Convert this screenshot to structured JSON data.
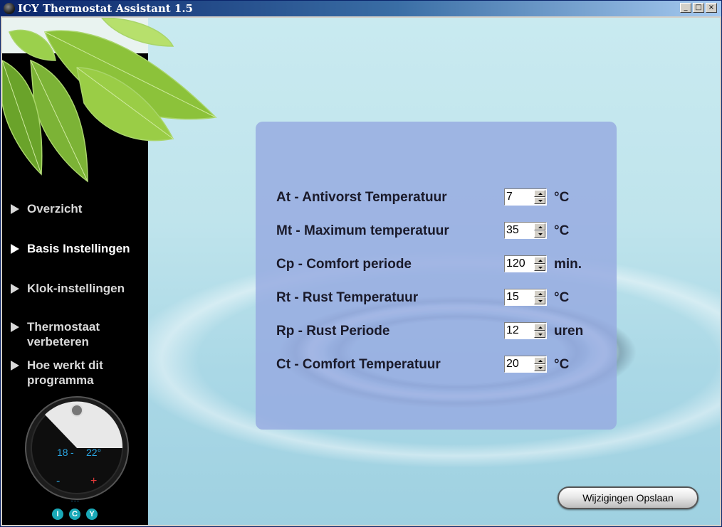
{
  "window": {
    "title": "ICY Thermostat Assistant 1.5"
  },
  "titlebar_buttons": {
    "minimize": "_",
    "maximize": "□",
    "close": "×"
  },
  "sidebar": {
    "items": [
      {
        "label": "Overzicht",
        "active": false
      },
      {
        "label": "Basis Instellingen",
        "active": true
      },
      {
        "label": "Klok-instellingen",
        "active": false
      },
      {
        "label": "Thermostaat verbeteren",
        "active": false
      },
      {
        "label": "Hoe werkt dit programma",
        "active": false
      }
    ]
  },
  "dial": {
    "low": "18",
    "high": "22°",
    "minus": "-",
    "plus": "+",
    "dots": "•••"
  },
  "logo": [
    "I",
    "C",
    "Y"
  ],
  "settings": [
    {
      "label": "At - Antivorst Temperatuur",
      "value": "7",
      "unit": "°C"
    },
    {
      "label": "Mt - Maximum temperatuur",
      "value": "35",
      "unit": "°C"
    },
    {
      "label": "Cp - Comfort periode",
      "value": "120",
      "unit": "min."
    },
    {
      "label": "Rt - Rust Temperatuur",
      "value": "15",
      "unit": "°C"
    },
    {
      "label": "Rp - Rust Periode",
      "value": "12",
      "unit": "uren"
    },
    {
      "label": "Ct - Comfort Temperatuur",
      "value": "20",
      "unit": "°C"
    }
  ],
  "save_button": {
    "label": "Wijzigingen Opslaan"
  },
  "colors": {
    "titlebar": "#0a246a",
    "panel": "#96aae1",
    "sidebar": "#000000",
    "logo": "#1aa9b8"
  }
}
